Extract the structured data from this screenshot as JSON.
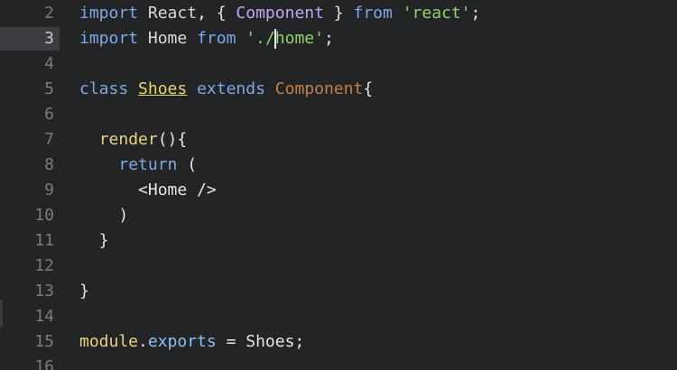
{
  "editor": {
    "active_line": 3,
    "lines": [
      {
        "n": "2",
        "tokens": [
          {
            "t": "import",
            "c": "kw"
          },
          {
            "t": " React",
            "c": "id"
          },
          {
            "t": ", { ",
            "c": "punc"
          },
          {
            "t": "Component",
            "c": "comp"
          },
          {
            "t": " } ",
            "c": "punc"
          },
          {
            "t": "from",
            "c": "kw"
          },
          {
            "t": " ",
            "c": "punc"
          },
          {
            "t": "'react'",
            "c": "str"
          },
          {
            "t": ";",
            "c": "punc"
          }
        ]
      },
      {
        "n": "3",
        "tokens": [
          {
            "t": "import",
            "c": "kw"
          },
          {
            "t": " Home ",
            "c": "id"
          },
          {
            "t": "from",
            "c": "kw"
          },
          {
            "t": " ",
            "c": "punc"
          },
          {
            "t": "'./",
            "c": "str"
          },
          {
            "cursor": true
          },
          {
            "t": "home'",
            "c": "str"
          },
          {
            "t": ";",
            "c": "punc"
          }
        ]
      },
      {
        "n": "4",
        "tokens": []
      },
      {
        "n": "5",
        "tokens": [
          {
            "t": "class",
            "c": "kw"
          },
          {
            "t": " ",
            "c": "punc"
          },
          {
            "t": "Shoes",
            "c": "cls"
          },
          {
            "t": " ",
            "c": "punc"
          },
          {
            "t": "extends",
            "c": "kw"
          },
          {
            "t": " ",
            "c": "punc"
          },
          {
            "t": "Component",
            "c": "inherit"
          },
          {
            "t": "{",
            "c": "punc"
          }
        ]
      },
      {
        "n": "6",
        "tokens": []
      },
      {
        "n": "7",
        "tokens": [
          {
            "t": "  ",
            "c": "punc"
          },
          {
            "t": "render",
            "c": "fn"
          },
          {
            "t": "(){",
            "c": "punc"
          }
        ]
      },
      {
        "n": "8",
        "tokens": [
          {
            "t": "    ",
            "c": "punc"
          },
          {
            "t": "return",
            "c": "kw"
          },
          {
            "t": " (",
            "c": "punc"
          }
        ]
      },
      {
        "n": "9",
        "tokens": [
          {
            "t": "      <Home />",
            "c": "punc"
          }
        ]
      },
      {
        "n": "10",
        "tokens": [
          {
            "t": "    )",
            "c": "punc"
          }
        ]
      },
      {
        "n": "11",
        "tokens": [
          {
            "t": "  }",
            "c": "punc"
          }
        ]
      },
      {
        "n": "12",
        "tokens": []
      },
      {
        "n": "13",
        "tokens": [
          {
            "t": "}",
            "c": "punc"
          }
        ]
      },
      {
        "n": "14",
        "tokens": []
      },
      {
        "n": "15",
        "tokens": [
          {
            "t": "module",
            "c": "fn"
          },
          {
            "t": ".",
            "c": "punc"
          },
          {
            "t": "exports",
            "c": "prop"
          },
          {
            "t": " = Shoes;",
            "c": "punc"
          }
        ]
      },
      {
        "n": "16",
        "tokens": []
      }
    ]
  }
}
